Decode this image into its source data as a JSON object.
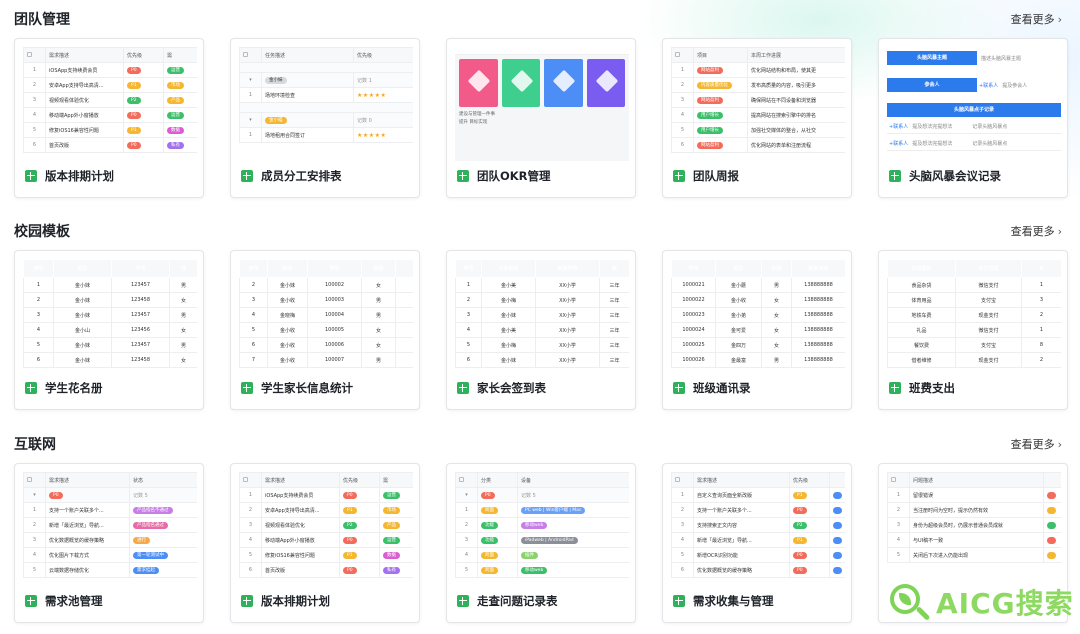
{
  "sections": [
    {
      "title": "团队管理",
      "more": "查看更多",
      "cards": [
        {
          "title": "版本排期计划",
          "headers": [
            "",
            "需求描述",
            "优先级",
            "需"
          ],
          "rows": [
            [
              "1",
              "iOSApp支持续费会员",
              "P0",
              "运营"
            ],
            [
              "2",
              "安卓App支持导出高清...",
              "P1",
              "市场"
            ],
            [
              "3",
              "视频观看体验优化",
              "P2",
              "产品"
            ],
            [
              "4",
              "移动端App外小窗播放",
              "P0",
              "运营"
            ],
            [
              "5",
              "修复iOS16兼容性问题",
              "P1",
              "数据"
            ],
            [
              "6",
              "首页改版",
              "P0",
              "私有"
            ]
          ]
        },
        {
          "title": "成员分工安排表",
          "headers": [
            "",
            "任务描述",
            "优先级"
          ],
          "groups": [
            {
              "name": "金小妹",
              "count": "记数 1",
              "rows": [
                [
                  "1",
                  "场地环境检查",
                  "★★★★★"
                ]
              ]
            },
            {
              "name": "金小喵",
              "count": "记数 0",
              "rows": [
                [
                  "1",
                  "场地租用合同签订",
                  "★★★★★"
                ]
              ]
            }
          ]
        },
        {
          "title": "团队OKR管理"
        },
        {
          "title": "团队周报",
          "headers": [
            "",
            "项目",
            "本周工作进展"
          ],
          "rows": [
            [
              "1",
              "网站盈利",
              "优化网站结构和布局，使其更"
            ],
            [
              "2",
              "内容质量优化",
              "发布高质量的内容，吸引更多"
            ],
            [
              "3",
              "网站盈利",
              "确保网站在不同设备和浏览器"
            ],
            [
              "4",
              "用户增长",
              "提高网站在搜索引擎中的排名"
            ],
            [
              "5",
              "用户增长",
              "加强社交媒体的整合，从社交"
            ],
            [
              "6",
              "网站盈利",
              "优化网站的表单和注册流程"
            ]
          ]
        },
        {
          "title": "头脑风暴会议记录",
          "brain": {
            "topic": "头脑风暴主题",
            "topic_hint": "描述头脑风暴主题",
            "members": "参会人",
            "add_member": "+联系人",
            "members_hint": "提及参会人",
            "notes": "头脑风暴点子记录",
            "note_hint": "提及想法完提想法",
            "note_hint2": "记录头脑风暴点"
          }
        }
      ]
    },
    {
      "title": "校园模板",
      "more": "查看更多",
      "cards": [
        {
          "title": "学生花名册",
          "headers": [
            "序号",
            "姓名",
            "学号",
            "性"
          ],
          "rows": [
            [
              "1",
              "金小妹",
              "123457",
              "男"
            ],
            [
              "2",
              "金小妹",
              "123458",
              "女"
            ],
            [
              "3",
              "金小妹",
              "123457",
              "男"
            ],
            [
              "4",
              "金小山",
              "123456",
              "女"
            ],
            [
              "5",
              "金小妹",
              "123457",
              "男"
            ],
            [
              "6",
              "金小妹",
              "123458",
              "女"
            ]
          ]
        },
        {
          "title": "学生家长信息统计",
          "headers": [
            "序号",
            "姓名",
            "学号",
            "性别",
            ""
          ],
          "rows": [
            [
              "2",
              "金小妹",
              "100002",
              "女",
              ""
            ],
            [
              "3",
              "金小收",
              "100003",
              "男",
              ""
            ],
            [
              "4",
              "金晓梅",
              "100004",
              "男",
              ""
            ],
            [
              "5",
              "金小收",
              "100005",
              "女",
              ""
            ],
            [
              "6",
              "金小收",
              "100006",
              "女",
              ""
            ],
            [
              "7",
              "金小收",
              "100007",
              "男",
              ""
            ]
          ]
        },
        {
          "title": "家长会签到表",
          "headers": [
            "序号",
            "子女姓名",
            "就读学校",
            "就"
          ],
          "rows": [
            [
              "1",
              "金小美",
              "XX小学",
              "三年"
            ],
            [
              "2",
              "金小梅",
              "XX小学",
              "三年"
            ],
            [
              "3",
              "金小妹",
              "XX小学",
              "三年"
            ],
            [
              "4",
              "金小美",
              "XX小学",
              "三年"
            ],
            [
              "5",
              "金小梅",
              "XX小学",
              "三年"
            ],
            [
              "6",
              "金小妹",
              "XX小学",
              "三年"
            ]
          ]
        },
        {
          "title": "班级通讯录",
          "headers": [
            "学号",
            "姓名",
            "性别",
            "联系电话"
          ],
          "rows": [
            [
              "1000021",
              "金小蘑",
              "男",
              "138888888"
            ],
            [
              "1000022",
              "金小收",
              "女",
              "138888888"
            ],
            [
              "1000023",
              "金小弟",
              "女",
              "138888888"
            ],
            [
              "1000024",
              "金可爱",
              "女",
              "138888888"
            ],
            [
              "1000025",
              "金四万",
              "女",
              "138888888"
            ],
            [
              "1000026",
              "金最富",
              "男",
              "138888888"
            ]
          ]
        },
        {
          "title": "班费支出",
          "headers": [
            "支出项目",
            "支付方式",
            "支"
          ],
          "rows": [
            [
              "食品杂货",
              "微信支付",
              "1"
            ],
            [
              "体育用品",
              "支付宝",
              "3"
            ],
            [
              "地铁车费",
              "现金支付",
              "2"
            ],
            [
              "礼品",
              "微信支付",
              "1"
            ],
            [
              "餐饮费",
              "支付宝",
              "8"
            ],
            [
              "借者维修",
              "现金支付",
              "2"
            ]
          ]
        }
      ]
    },
    {
      "title": "互联网",
      "more": "查看更多",
      "cards": [
        {
          "title": "需求池管理",
          "headers": [
            "",
            "需求描述",
            "状态"
          ],
          "group": {
            "name": "P0",
            "count": "记数 5"
          },
          "rows": [
            [
              "1",
              "支持一个账户关联多个...",
              "产品指名不通过"
            ],
            [
              "2",
              "新增「最近浏览」导航...",
              "产品指名通过"
            ],
            [
              "3",
              "优化数据概览的缓存策略",
              "进行"
            ],
            [
              "4",
              "优化图片下载方式",
              "第一轮测试中"
            ],
            [
              "5",
              "云端数据存储优化",
              "需求挂起"
            ]
          ]
        },
        {
          "title": "版本排期计划",
          "headers": [
            "",
            "需求描述",
            "优先级",
            "需"
          ],
          "rows": [
            [
              "1",
              "iOSApp支持续费会员",
              "P0",
              "运营"
            ],
            [
              "2",
              "安卓App支持导出高清...",
              "P1",
              "市场"
            ],
            [
              "3",
              "视频观看体验优化",
              "P2",
              "产品"
            ],
            [
              "4",
              "移动端App外小窗播放",
              "P0",
              "运营"
            ],
            [
              "5",
              "修复iOS16兼容性问题",
              "P1",
              "数据"
            ],
            [
              "6",
              "首页改版",
              "P0",
              "私有"
            ]
          ]
        },
        {
          "title": "走查问题记录表",
          "headers": [
            "",
            "分类",
            "设备"
          ],
          "group": {
            "name": "P0",
            "count": "记数 5"
          },
          "rows": [
            [
              "1",
              "跨面",
              "PC web | Win客户端 | Mac"
            ],
            [
              "2",
              "功能",
              "移动web"
            ],
            [
              "3",
              "功能",
              "iPadweb | AndroidPad"
            ],
            [
              "4",
              "跨面",
              "插件"
            ],
            [
              "5",
              "跨面",
              "移动web"
            ]
          ]
        },
        {
          "title": "需求收集与管理",
          "headers": [
            "",
            "需求描述",
            "优先级",
            ""
          ],
          "rows": [
            [
              "1",
              "自定义查询页面全新改版",
              "P1",
              ""
            ],
            [
              "2",
              "支持一个账户关联多个...",
              "P0",
              ""
            ],
            [
              "3",
              "支持搜索正文内容",
              "P2",
              ""
            ],
            [
              "4",
              "新增「最近浏览」导航...",
              "P1",
              ""
            ],
            [
              "5",
              "新增OCR识别功能",
              "P0",
              ""
            ],
            [
              "6",
              "优化数据概览的缓存策略",
              "P0",
              ""
            ]
          ]
        },
        {
          "title": "",
          "headers": [
            "",
            "问题描述",
            ""
          ],
          "rows": [
            [
              "1",
              "留很错误",
              ""
            ],
            [
              "2",
              "当注册时间为空时，提示仍然有效",
              ""
            ],
            [
              "3",
              "身份为超级会员时，仍展示普通会员成就",
              ""
            ],
            [
              "4",
              "与UI稿不一致",
              ""
            ],
            [
              "5",
              "关闭后下次进入仍能出现",
              ""
            ]
          ]
        }
      ]
    }
  ],
  "okr_text": [
    "建设与管理一件事",
    "提升 目标实现"
  ],
  "watermark": "AICG搜索",
  "colors": {
    "green": "#25a24a",
    "orange": "#f47a36",
    "blue": "#2c7bec"
  }
}
